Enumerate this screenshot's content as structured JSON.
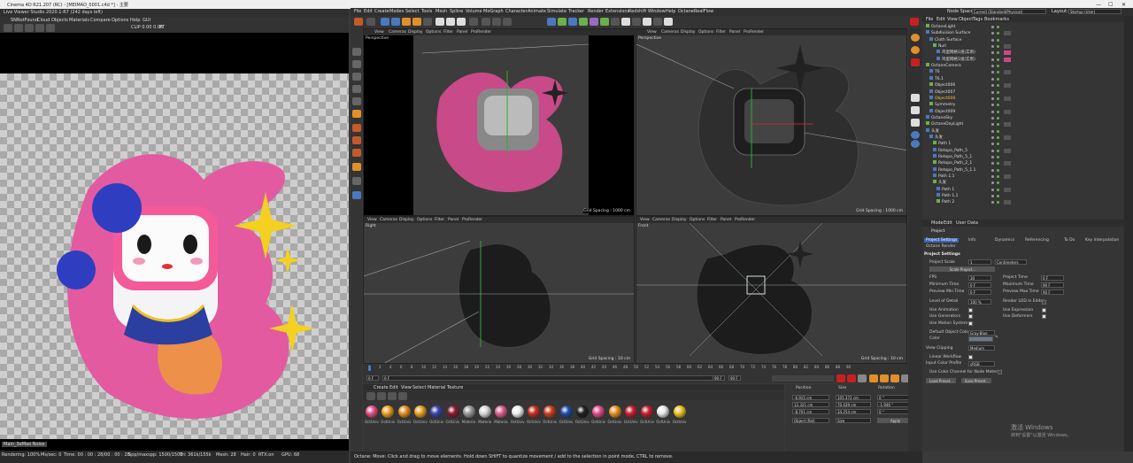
{
  "window_title": "Cinema 4D R21.207 (RC) - [MEIMAO_0001.c4d *] - 主要",
  "viewer_title": "Live Viewer Studio 2020.1-R7 (242 days left)",
  "left_menu": [
    "SNNotFound",
    "Cloud",
    "Objects",
    "Materials",
    "Compare",
    "Options",
    "Help",
    "GUI"
  ],
  "viewer_toolbar": {
    "clip": "CLIP 0.00 0.06",
    "pt": "PT"
  },
  "main_menu": [
    "File",
    "Edit",
    "Create",
    "Modes",
    "Select",
    "Tools",
    "Mesh",
    "Spline",
    "Volume",
    "MoGraph",
    "Character",
    "Animate",
    "Simulate",
    "Tracker",
    "Render",
    "Extensions",
    "Redshift",
    "Window",
    "Help",
    "Octane",
    "RealFlow"
  ],
  "node_space": {
    "label": "Node Space:",
    "value": "Current (Standard/Physical)"
  },
  "layout": {
    "label": "Layout:",
    "value": "Startup (User)"
  },
  "viewport_menu": [
    "View",
    "Cameras",
    "Display",
    "Options",
    "Filter",
    "Panel",
    "ProRender"
  ],
  "viewports": [
    {
      "label": "Perspective",
      "grid": "Grid Spacing : 1000 cm"
    },
    {
      "label": "Perspective",
      "grid": "Grid Spacing : 1000 cm"
    },
    {
      "label": "Right",
      "grid": "Grid Spacing : 10 cm"
    },
    {
      "label": "Front",
      "grid": "Grid Spacing : 10 cm"
    }
  ],
  "object_menu": [
    "File",
    "Edit",
    "View",
    "Object",
    "Tags",
    "Bookmarks"
  ],
  "objects": [
    "OctaneLight",
    "Subdivision Surface",
    "Cloth Surface",
    "Null",
    "鸡蛋网格1组(实例)",
    "鸡蛋网格1组(实例)",
    "OctaneCamera",
    "T6",
    "T6.1",
    "Object006",
    "Object007",
    "Object008",
    "Symmetry",
    "Object009",
    "OctaneSky",
    "OctaneDayLight",
    "头发",
    "头发",
    "Path 1",
    "Retopo_Path_5",
    "Retopo_Path_5_1",
    "Retopo_Path_2_1",
    "Retopo_Path_5_1.1",
    "Path 1.1",
    "头发",
    "Path 1",
    "Path 1.1",
    "Path 2"
  ],
  "attr_menu": [
    "Mode",
    "Edit",
    "User Data"
  ],
  "attr_title": "Project",
  "attr_tabs": [
    "Project Settings",
    "Info",
    "Dynamics",
    "Referencing",
    "To Do",
    "Key Interpolation"
  ],
  "octane_render": "Octane Render",
  "project_settings": {
    "heading": "Project Settings",
    "project_scale_label": "Project Scale",
    "project_scale_value": "1",
    "project_scale_unit": "Centimeters",
    "scale_project": "Scale Project...",
    "fps_label": "FPS",
    "fps": "30",
    "project_time_label": "Project Time",
    "project_time": "0 F",
    "min_time_label": "Minimum Time",
    "min_time": "0 F",
    "max_time_label": "Maximum Time",
    "max_time": "90 F",
    "prev_min_label": "Preview Min Time",
    "prev_min": "0 F",
    "prev_max_label": "Preview Max Time",
    "prev_max": "90 F",
    "lod_label": "Level of Detail",
    "lod": "100 %",
    "render_lod": "Render LOD in Editor",
    "use_animation": "Use Animation",
    "use_expression": "Use Expression",
    "use_generators": "Use Generators",
    "use_deformers": "Use Deformers",
    "use_motion": "Use Motion System",
    "default_color_label": "Default Object Color",
    "default_color": "Gray-Blue",
    "color_label": "Color",
    "view_clipping_label": "View Clipping",
    "view_clipping": "Medium",
    "linear_workflow": "Linear Workflow",
    "input_color_label": "Input Color Profile",
    "input_color": "sRGB",
    "use_color_channel": "Use Color Channel for Node Material",
    "load_preset": "Load Preset...",
    "save_preset": "Save Preset..."
  },
  "timeline": {
    "ticks": [
      "0",
      "2",
      "4",
      "6",
      "8",
      "10",
      "12",
      "14",
      "16",
      "18",
      "20",
      "22",
      "24",
      "26",
      "28",
      "30",
      "32",
      "34",
      "36",
      "38",
      "40",
      "42",
      "44",
      "46",
      "48",
      "50",
      "52",
      "54",
      "56",
      "58",
      "60",
      "62",
      "64",
      "66",
      "68",
      "70",
      "72",
      "74",
      "76",
      "78",
      "80",
      "82",
      "84",
      "86",
      "88",
      "90"
    ],
    "start": "0 F",
    "field": "0 F",
    "end": "90 F",
    "end2": "90 F"
  },
  "mat_menu": [
    "Create",
    "Edit",
    "View",
    "Select",
    "Material",
    "Texture"
  ],
  "materials": [
    {
      "name": "OctUniv",
      "color": "#e0508a"
    },
    {
      "name": "OctUniv",
      "color": "#e8a020"
    },
    {
      "name": "OctUniv",
      "color": "#e09020"
    },
    {
      "name": "OctUniv",
      "color": "#e8a020"
    },
    {
      "name": "OctUniv",
      "color": "#3b45b0"
    },
    {
      "name": "OctUniv",
      "color": "#8a1c30"
    },
    {
      "name": "Materia",
      "color": "#9a9a9a"
    },
    {
      "name": "Materia",
      "color": "#d8d8d8"
    },
    {
      "name": "Materia",
      "color": "#e06090"
    },
    {
      "name": "OctUniv",
      "color": "#f0f0f0"
    },
    {
      "name": "OctUniv",
      "color": "#c83020"
    },
    {
      "name": "OctUniv",
      "color": "#d04020"
    },
    {
      "name": "OctUniv",
      "color": "#1e4ea8"
    },
    {
      "name": "OctUniv",
      "color": "#202020"
    },
    {
      "name": "OctUniv",
      "color": "#e84a8a"
    },
    {
      "name": "OctUniv",
      "color": "#e89020"
    },
    {
      "name": "OctUniv",
      "color": "#c82030"
    },
    {
      "name": "OctUniv",
      "color": "#c82030"
    },
    {
      "name": "OctUniv",
      "color": "#e8e8e8"
    },
    {
      "name": "OctUniv",
      "color": "#f0c020"
    }
  ],
  "coords": {
    "position": "Position",
    "size": "Size",
    "rotation": "Rotation",
    "x_pos": "-6.915 cm",
    "y_pos": "12.321 cm",
    "z_pos": "-8.701 cm",
    "x_size": "105.372 cm",
    "y_size": "70.439 cm",
    "z_size": "34.254 cm",
    "h": "0 °",
    "p": "-1.946 °",
    "b": "0 °",
    "mode": "Object (Rel)",
    "size_mode": "Size",
    "apply": "Apply"
  },
  "status_line": "Octane:    Move: Click and drag to move elements. Hold down SHIFT to quantize movement / add to the selection in point mode, CTRL to remove.",
  "render_status": {
    "rendering": "Rendering: 100%",
    "ms": "Ms/sec: 0",
    "time": "Time: 00 : 00 : 28/00 : 00 : 28",
    "spp": "Spp/maxspp: 1500/1500",
    "tri": "Tri: 361k/155k",
    "mesh": "Mesh: 28",
    "hair": "Hair: 0",
    "rtx": "RTX:on",
    "gpu": "GPU: 68"
  },
  "viewer_tag": "Main_3eMao Noise",
  "activate": {
    "title": "激活 Windows",
    "sub": "转到\"设置\"以激活 Windows。"
  }
}
